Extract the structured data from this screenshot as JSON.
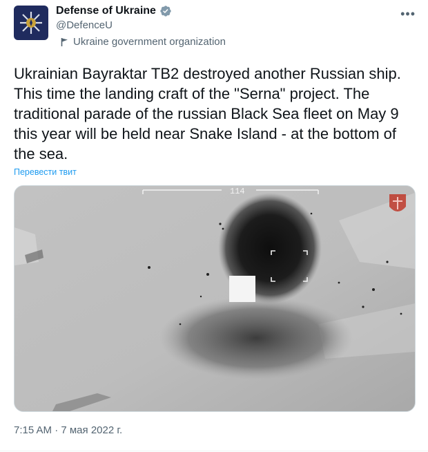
{
  "author": {
    "name": "Defense of Ukraine",
    "handle": "@DefenceU",
    "label": "Ukraine government organization",
    "avatar_icon": "ukraine-defense-emblem-icon",
    "verified_icon": "verified-badge-icon"
  },
  "tweet": {
    "text": "Ukrainian Bayraktar TB2 destroyed another Russian ship. This time the landing craft of the \"Serna\" project. The traditional parade of the russian Black Sea fleet on May 9 this year will be held near Snake Island - at the bottom of the sea.",
    "translate_link": "Перевести твит",
    "timestamp": "7:15 AM · 7 мая 2022 г."
  },
  "media": {
    "hud_readout": "114",
    "type": "drone-strike-video-frame"
  },
  "colors": {
    "text": "#0f1419",
    "muted": "#536471",
    "link": "#1d9bf0",
    "verified": "#829aab"
  },
  "more_icon": "more-options-icon"
}
